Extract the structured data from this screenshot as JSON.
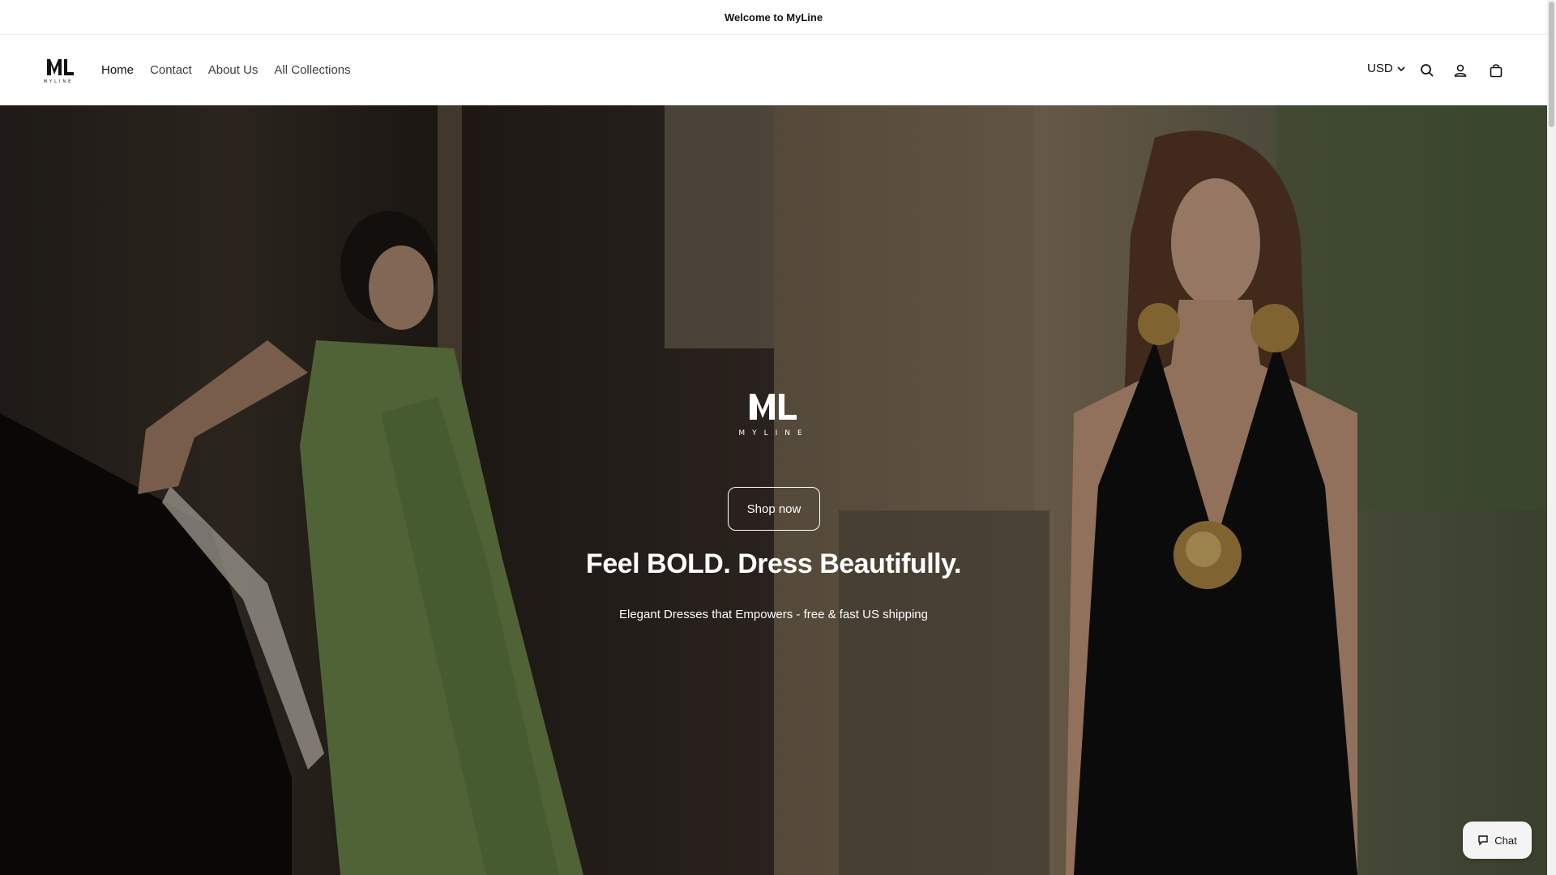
{
  "announcement": {
    "text": "Welcome to MyLine"
  },
  "brand": {
    "logo_text": "ML",
    "wordmark": "MYLINE"
  },
  "nav": {
    "items": [
      {
        "label": "Home",
        "active": true
      },
      {
        "label": "Contact",
        "active": false
      },
      {
        "label": "About Us",
        "active": false
      },
      {
        "label": "All Collections",
        "active": false
      }
    ]
  },
  "header_actions": {
    "currency": "USD",
    "icons": [
      "search-icon",
      "account-icon",
      "cart-icon"
    ]
  },
  "hero": {
    "cta_label": "Shop now",
    "title": "Feel BOLD. Dress Beautifully.",
    "subtitle": "Elegant Dresses that Empowers - free & fast US shipping",
    "left_image": "woman in green pleated gown leaning on piano",
    "right_image": "woman in black halter dress with gold flower"
  },
  "chat": {
    "label": "Chat"
  },
  "colors": {
    "text": "#121212",
    "accent": "#ffffff"
  }
}
